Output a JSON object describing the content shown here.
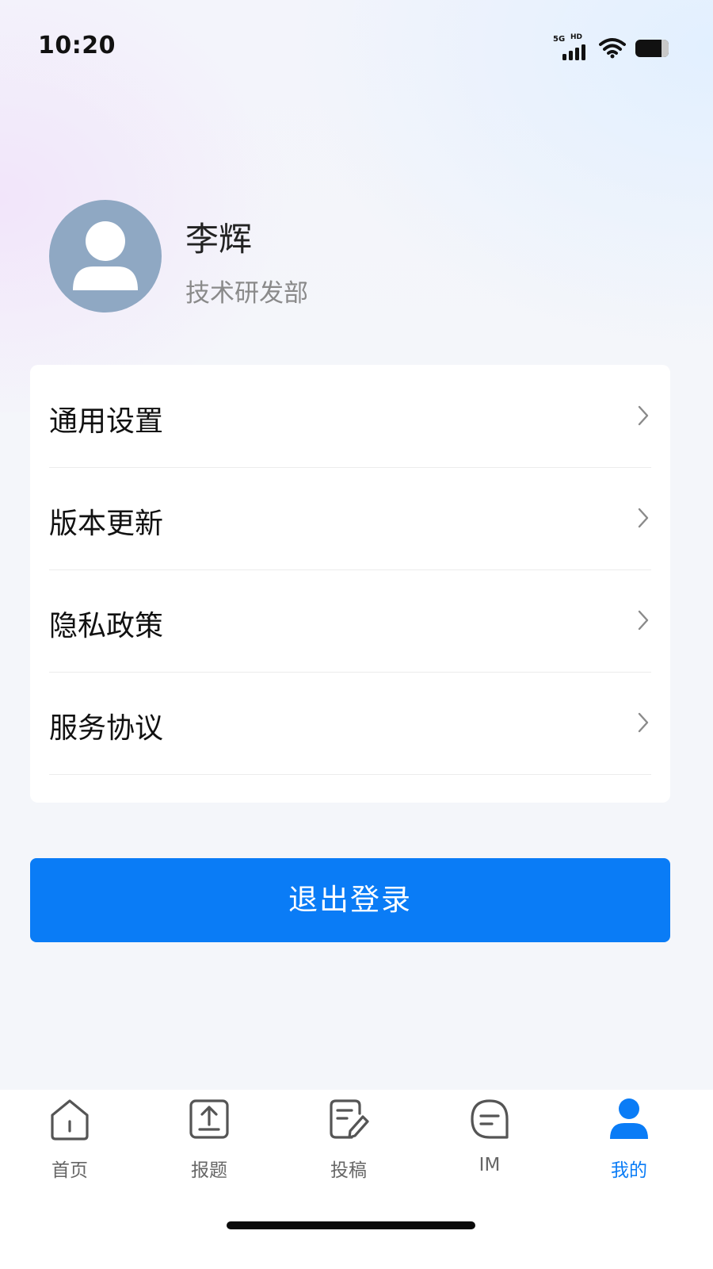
{
  "status_bar": {
    "time": "10:20",
    "network_5g": "5G",
    "network_hd": "HD",
    "icons": [
      "signal-icon",
      "wifi-icon",
      "battery-icon"
    ]
  },
  "profile": {
    "name": "李辉",
    "department": "技术研发部",
    "avatar_icon": "user-avatar-icon"
  },
  "menu": {
    "items": [
      {
        "label": "通用设置"
      },
      {
        "label": "版本更新"
      },
      {
        "label": "隐私政策"
      },
      {
        "label": "服务协议"
      }
    ],
    "chevron_icon": "chevron-right-icon"
  },
  "logout": {
    "label": "退出登录",
    "color": "#0A7CF6"
  },
  "tab_bar": {
    "tabs": [
      {
        "label": "首页",
        "icon": "home-icon",
        "active": false
      },
      {
        "label": "报题",
        "icon": "upload-icon",
        "active": false
      },
      {
        "label": "投稿",
        "icon": "edit-document-icon",
        "active": false
      },
      {
        "label": "IM",
        "icon": "message-icon",
        "active": false
      },
      {
        "label": "我的",
        "icon": "profile-icon",
        "active": true
      }
    ],
    "active_color": "#0A7CF6",
    "inactive_color": "#666666"
  }
}
